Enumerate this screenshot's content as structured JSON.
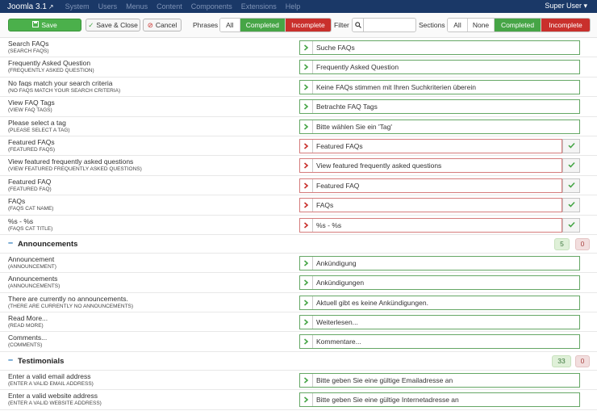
{
  "navbar": {
    "brand": "Joomla 3.1",
    "brand_ext_icon": "external-link-icon",
    "menu": [
      "System",
      "Users",
      "Menus",
      "Content",
      "Components",
      "Extensions",
      "Help"
    ],
    "user": "Super User"
  },
  "toolbar": {
    "save": "Save",
    "save_close": "Save & Close",
    "cancel": "Cancel",
    "phrases_label": "Phrases",
    "phrases": [
      "All",
      "Completed",
      "Incomplete"
    ],
    "filter_label": "Filter",
    "filter_value": "",
    "sections_label": "Sections",
    "sections": [
      "All",
      "None",
      "Completed",
      "Incomplete"
    ]
  },
  "colors": {
    "navbar": "#1a3867",
    "completed_green": "#46a546",
    "incomplete_red": "#c9302c",
    "ok_border": "#65a765",
    "bad_border": "#d57c7c"
  },
  "group1": [
    {
      "label": "Search FAQs",
      "key": "(SEARCH FAQS)",
      "value": "Suche FAQs",
      "status": "ok"
    },
    {
      "label": "Frequently Asked Question",
      "key": "(FREQUENTLY ASKED QUESTION)",
      "value": "Frequently Asked Question",
      "status": "ok"
    },
    {
      "label": "No faqs match your search criteria",
      "key": "(NO FAQS MATCH YOUR SEARCH CRITERIA)",
      "value": "Keine FAQs stimmen mit Ihren Suchkriterien überein",
      "status": "ok"
    },
    {
      "label": "View FAQ Tags",
      "key": "(VIEW FAQ TAGS)",
      "value": "Betrachte FAQ Tags",
      "status": "ok"
    },
    {
      "label": "Please select a tag",
      "key": "(PLEASE SELECT A TAG)",
      "value": "Bitte wählen Sie ein 'Tag'",
      "status": "ok"
    },
    {
      "label": "Featured FAQs",
      "key": "(FEATURED FAQS)",
      "value": "Featured FAQs",
      "status": "bad"
    },
    {
      "label": "View featured frequently asked questions",
      "key": "(VIEW FEATURED FREQUENTLY ASKED QUESTIONS)",
      "value": "View featured frequently asked questions",
      "status": "bad"
    },
    {
      "label": "Featured FAQ",
      "key": "(FEATURED FAQ)",
      "value": "Featured FAQ",
      "status": "bad"
    },
    {
      "label": "FAQs",
      "key": "(FAQS CAT NAME)",
      "value": "FAQs",
      "status": "bad"
    },
    {
      "label": "%s - %s",
      "key": "(FAQS CAT TITLE)",
      "value": "%s - %s",
      "status": "bad"
    }
  ],
  "announcements": {
    "title": "Announcements",
    "completed": "5",
    "incomplete": "0",
    "rows": [
      {
        "label": "Announcement",
        "key": "(ANNOUNCEMENT)",
        "value": "Ankündigung",
        "status": "ok"
      },
      {
        "label": "Announcements",
        "key": "(ANNOUNCEMENTS)",
        "value": "Ankündigungen",
        "status": "ok"
      },
      {
        "label": "There are currently no announcements.",
        "key": "(THERE ARE CURRENTLY NO ANNOUNCEMENTS)",
        "value": "Aktuell gibt es keine Ankündigungen.",
        "status": "ok"
      },
      {
        "label": "Read More...",
        "key": "(READ MORE)",
        "value": "Weiterlesen...",
        "status": "ok"
      },
      {
        "label": "Comments...",
        "key": "(COMMENTS)",
        "value": "Kommentare...",
        "status": "ok"
      }
    ]
  },
  "testimonials": {
    "title": "Testimonials",
    "completed": "33",
    "incomplete": "0",
    "rows": [
      {
        "label": "Enter a valid email address",
        "key": "(ENTER A VALID EMAIL ADDRESS)",
        "value": "Bitte geben Sie eine gültige Emailadresse an",
        "status": "ok"
      },
      {
        "label": "Enter a valid website address",
        "key": "(ENTER A VALID WEBSITE ADDRESS)",
        "value": "Bitte geben Sie eine gültige Internetadresse an",
        "status": "ok"
      }
    ]
  }
}
